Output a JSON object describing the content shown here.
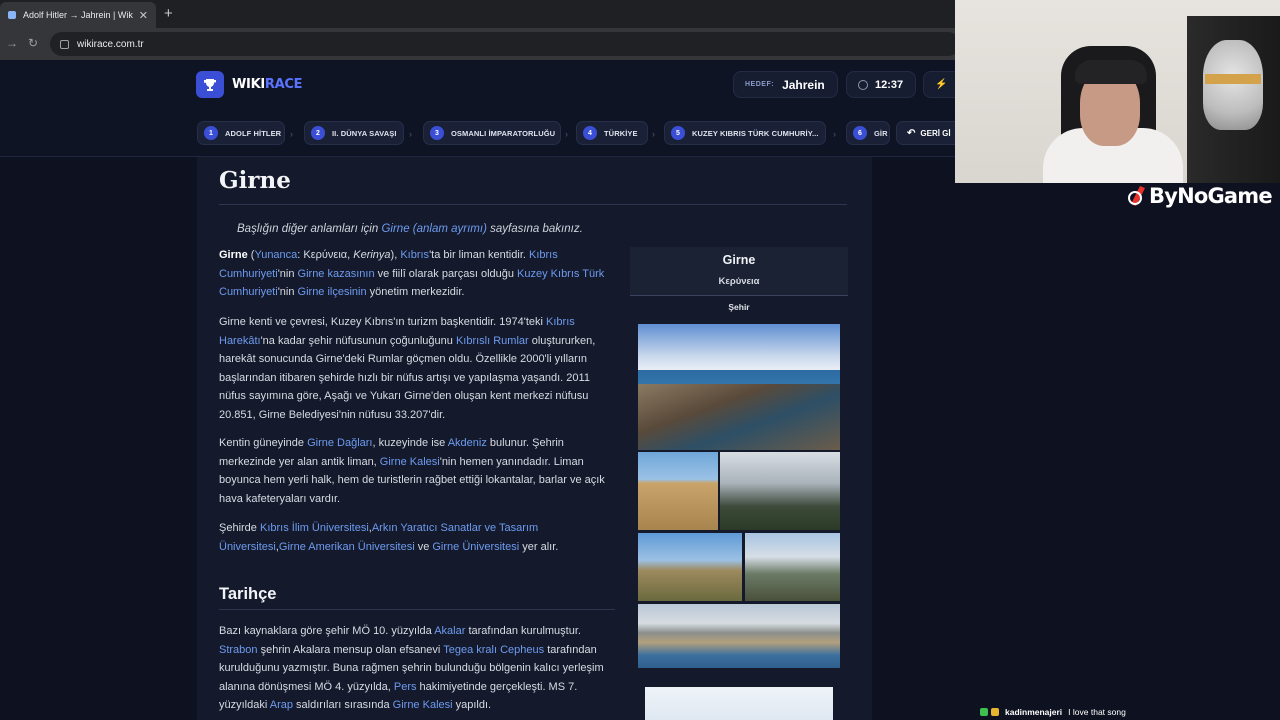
{
  "browser": {
    "tab_title": "Adolf Hitler → Jahrein | WikiRac",
    "tab_close": "✕",
    "new_tab": "+",
    "url": "wikirace.com.tr"
  },
  "app": {
    "logo_part1": "WIKI",
    "logo_part2": "RACE",
    "target_label": "HEDEF:",
    "target_value": "Jahrein",
    "timer": "12:37",
    "accent_color": "#3a4fd6",
    "link_color": "#6e9bf0"
  },
  "breadcrumbs": [
    {
      "num": "1",
      "label": "ADOLF HİTLER"
    },
    {
      "num": "2",
      "label": "II. DÜNYA SAVAŞI"
    },
    {
      "num": "3",
      "label": "OSMANLI İMPARATORLUĞU"
    },
    {
      "num": "4",
      "label": "TÜRKİYE"
    },
    {
      "num": "5",
      "label": "KUZEY KIBRIS TÜRK CUMHURİY..."
    },
    {
      "num": "6",
      "label": "GİR"
    }
  ],
  "back_button": "GERİ Gİ",
  "article": {
    "title": "Girne",
    "hatnote_pre": "Başlığın diğer anlamları için ",
    "hatnote_link": "Girne (anlam ayrımı)",
    "hatnote_post": " sayfasına bakınız.",
    "p1": {
      "t1": "Girne",
      "t2": " (",
      "l1": "Yunanca",
      "t3": ": Κερύνεια, ",
      "t4": "Kerinya",
      "t5": "), ",
      "l2": "Kıbrıs",
      "t6": "'ta bir liman kentidir. ",
      "l3": "Kıbrıs Cumhuriyeti",
      "t7": "'nin ",
      "l4": "Girne kazasının",
      "t8": " ve fiilî olarak parçası olduğu ",
      "l5": "Kuzey Kıbrıs Türk Cumhuriyeti",
      "t9": "'nin ",
      "l6": "Girne ilçesinin",
      "t10": " yönetim merkezidir."
    },
    "p2": {
      "t1": "Girne kenti ve çevresi, Kuzey Kıbrıs'ın turizm başkentidir. 1974'teki ",
      "l1": "Kıbrıs Harekâtı",
      "t2": "'na kadar şehir nüfusunun çoğunluğunu ",
      "l2": "Kıbrıslı Rumlar",
      "t3": " oluştururken, harekât sonucunda Girne'deki Rumlar göçmen oldu. Özellikle 2000'li yılların başlarından itibaren şehirde hızlı bir nüfus artışı ve yapılaşma yaşandı. 2011 nüfus sayımına göre, Aşağı ve Yukarı Girne'den oluşan kent merkezi nüfusu 20.851, Girne Belediyesi'nin nüfusu 33.207'dir."
    },
    "p3": {
      "t1": "Kentin güneyinde ",
      "l1": "Girne Dağları",
      "t2": ", kuzeyinde ise ",
      "l2": "Akdeniz",
      "t3": " bulunur. Şehrin merkezinde yer alan antik liman, ",
      "l3": "Girne Kalesi",
      "t4": "'nin hemen yanındadır. Liman boyunca hem yerli halk, hem de turistlerin rağbet ettiği lokantalar, barlar ve açık hava kafeteryaları vardır."
    },
    "p4": {
      "t1": "Şehirde ",
      "l1": "Kıbrıs İlim Üniversitesi",
      "t2": ",",
      "l2": "Arkın Yaratıcı Sanatlar ve Tasarım Üniversitesi",
      "t3": ",",
      "l3": "Girne Amerikan Üniversitesi",
      "t4": " ve ",
      "l4": "Girne Üniversitesi",
      "t5": " yer alır."
    },
    "section": "Tarihçe",
    "p5": {
      "t1": "Bazı kaynaklara göre şehir MÖ 10. yüzyılda ",
      "l1": "Akalar",
      "t2": " tarafından kurulmuştur. ",
      "l2": "Strabon",
      "t3": " şehrin Akalara mensup olan efsanevi ",
      "l3": "Tegea kralı Cepheus",
      "t4": " tarafından kurulduğunu yazmıştır. Buna rağmen şehrin bulunduğu bölgenin kalıcı yerleşim alanına dönüşmesi MÖ 4. yüzyılda, ",
      "l4": "Pers",
      "t5": " hakimiyetinde gerçekleşti. MS 7. yüzyıldaki ",
      "l5": "Arap",
      "t6": " saldırıları sırasında ",
      "l6": "Girne Kalesi",
      "t7": " yapıldı."
    }
  },
  "infobox": {
    "name": "Girne",
    "native_name": "Κερύνεια",
    "type": "Şehir"
  },
  "overlay": {
    "brand": "ByNoGame",
    "chat_user": "kadinmenajeri",
    "chat_message": "I love that song"
  }
}
